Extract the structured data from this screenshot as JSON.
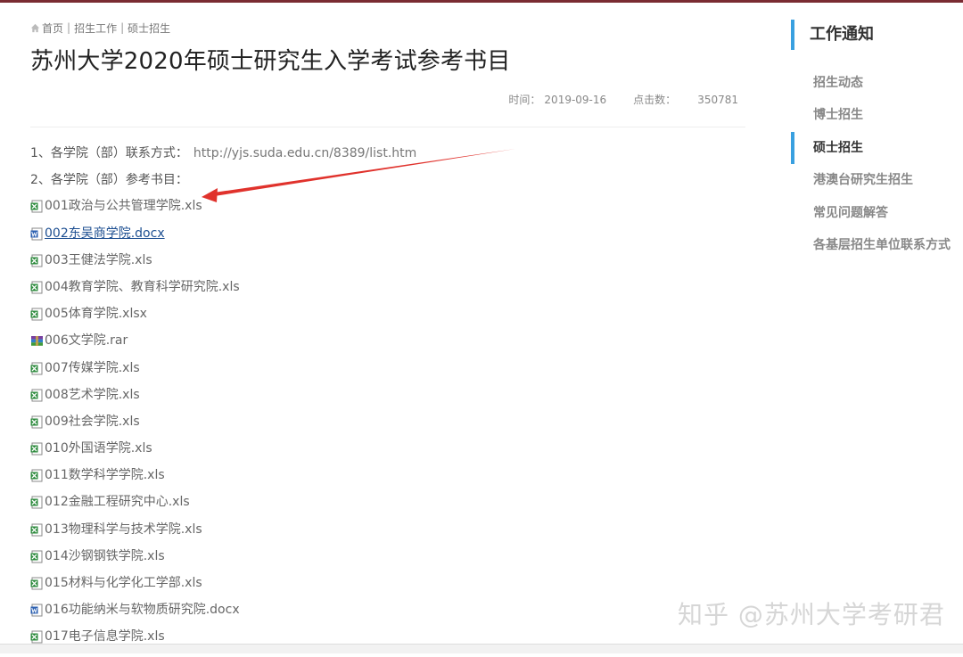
{
  "breadcrumb": {
    "home": "首页",
    "sep": "|",
    "item1": "招生工作",
    "item2": "硕士招生"
  },
  "title": "苏州大学2020年硕士研究生入学考试参考书目",
  "meta": {
    "time_label": "时间：",
    "time": "2019-09-16",
    "clicks_label": "点击数：",
    "clicks": "350781"
  },
  "content": {
    "line1_label": "1、各学院（部）联系方式：",
    "line1_url": "http://yjs.suda.edu.cn/8389/list.htm",
    "line2_label": "2、各学院（部）参考书目："
  },
  "files": [
    {
      "name": "001政治与公共管理学院.xls",
      "icon": "excel-file-icon"
    },
    {
      "name": "002东吴商学院.docx",
      "icon": "word-file-icon"
    },
    {
      "name": "003王健法学院.xls",
      "icon": "excel-file-icon"
    },
    {
      "name": "004教育学院、教育科学研究院.xls",
      "icon": "excel-file-icon"
    },
    {
      "name": "005体育学院.xlsx",
      "icon": "excel-file-icon"
    },
    {
      "name": "006文学院.rar",
      "icon": "archive-file-icon"
    },
    {
      "name": "007传媒学院.xls",
      "icon": "excel-file-icon"
    },
    {
      "name": "008艺术学院.xls",
      "icon": "excel-file-icon"
    },
    {
      "name": "009社会学院.xls",
      "icon": "excel-file-icon"
    },
    {
      "name": "010外国语学院.xls",
      "icon": "excel-file-icon"
    },
    {
      "name": "011数学科学学院.xls",
      "icon": "excel-file-icon"
    },
    {
      "name": "012金融工程研究中心.xls",
      "icon": "excel-file-icon"
    },
    {
      "name": "013物理科学与技术学院.xls",
      "icon": "excel-file-icon"
    },
    {
      "name": "014沙钢钢铁学院.xls",
      "icon": "excel-file-icon"
    },
    {
      "name": "015材料与化学化工学部.xls",
      "icon": "excel-file-icon"
    },
    {
      "name": "016功能纳米与软物质研究院.docx",
      "icon": "word-file-icon"
    },
    {
      "name": "017电子信息学院.xls",
      "icon": "excel-file-icon"
    }
  ],
  "sidebar": {
    "heading": "工作通知",
    "items": [
      {
        "label": "招生动态"
      },
      {
        "label": "博士招生"
      },
      {
        "label": "硕士招生"
      },
      {
        "label": "港澳台研究生招生"
      },
      {
        "label": "常见问题解答"
      },
      {
        "label": "各基层招生单位联系方式"
      }
    ]
  },
  "watermark": "知乎 @苏州大学考研君",
  "colors": {
    "accent": "#39a0e0",
    "topbar": "#7a2b32",
    "arrow": "#e0322c",
    "visited_link": "#1d4f91"
  }
}
